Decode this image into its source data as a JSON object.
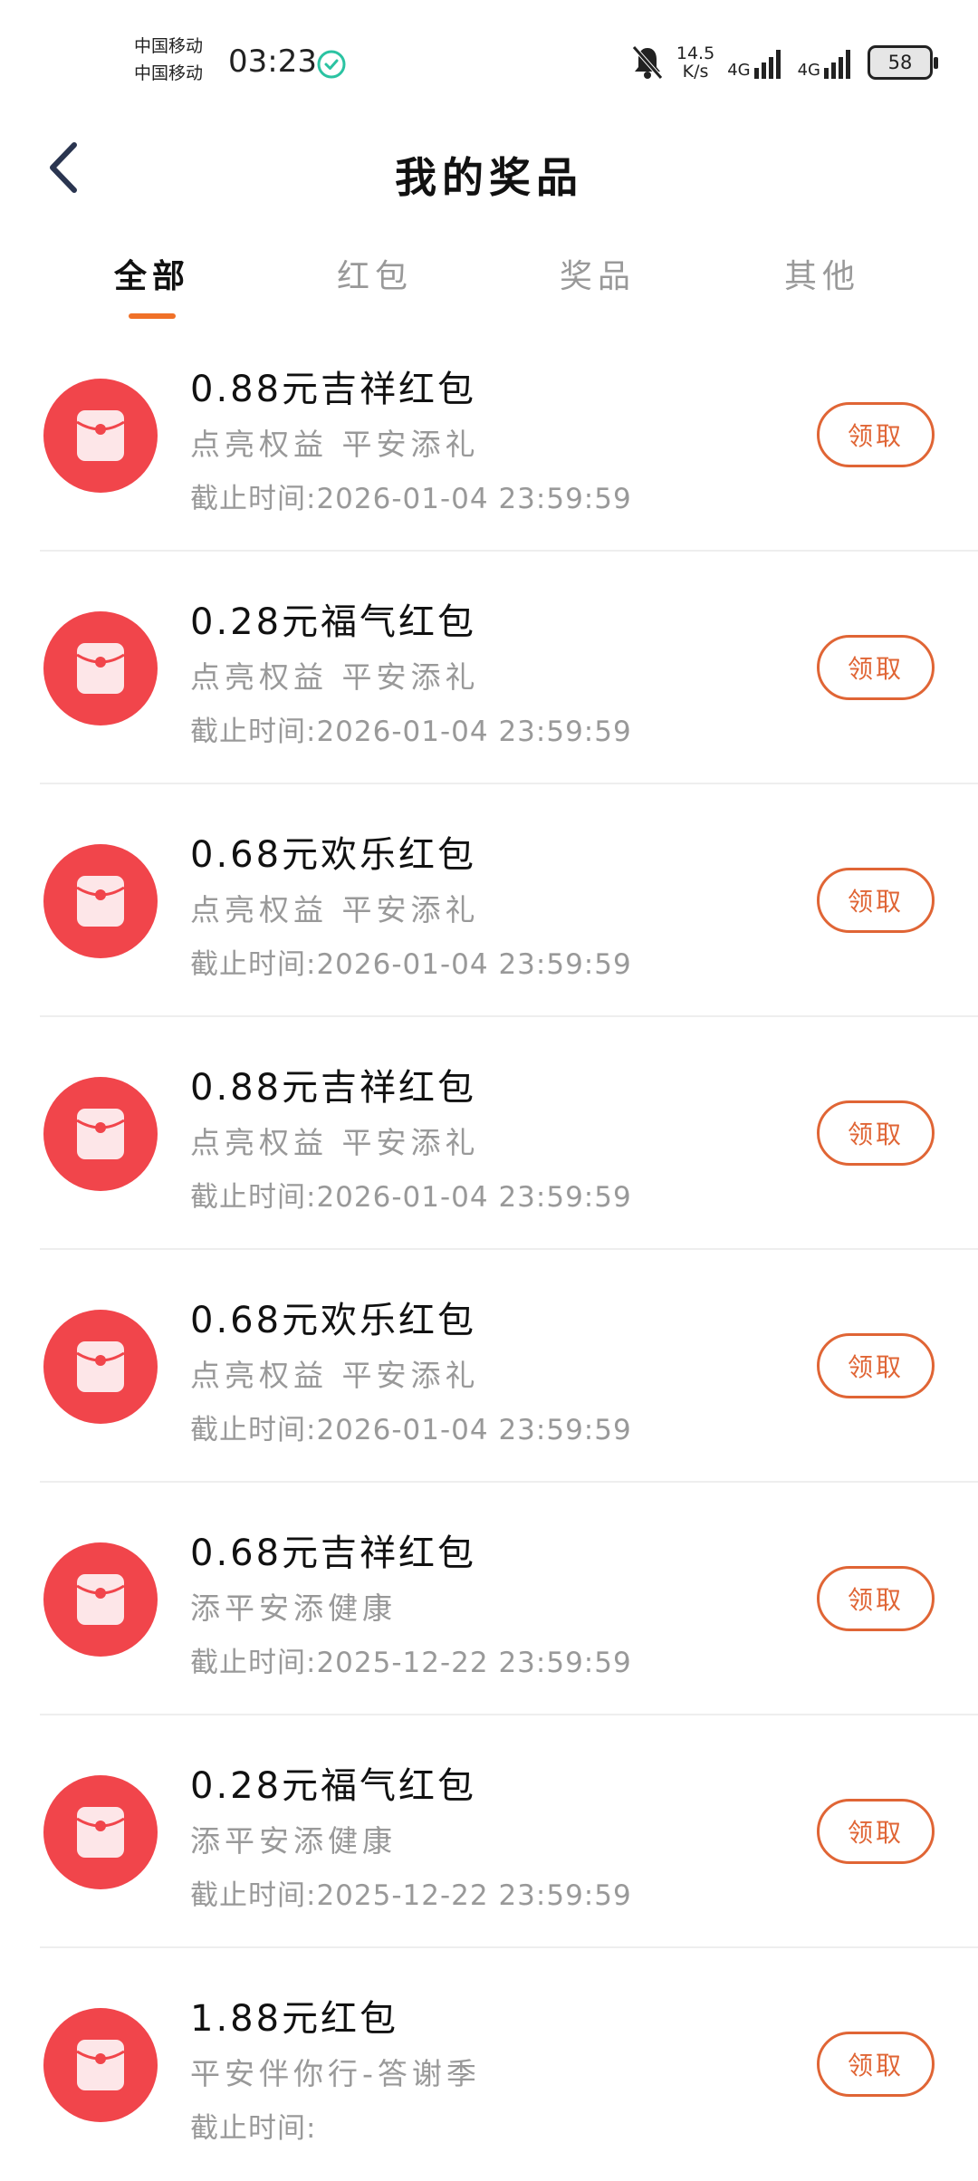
{
  "status_bar": {
    "carrier_1": "中国移动",
    "carrier_2": "中国移动",
    "time": "03:23",
    "net_speed_value": "14.5",
    "net_speed_unit": "K/s",
    "signal_1_label": "4G",
    "signal_2_label": "4G",
    "battery": "58"
  },
  "header": {
    "title": "我的奖品",
    "back_icon": "chevron-left-icon"
  },
  "tabs": [
    {
      "label": "全部",
      "active": true
    },
    {
      "label": "红包",
      "active": false
    },
    {
      "label": "奖品",
      "active": false
    },
    {
      "label": "其他",
      "active": false
    }
  ],
  "prizes": [
    {
      "title": "0.88元吉祥红包",
      "desc": "点亮权益 平安添礼",
      "deadline": "截止时间:2026-01-04 23:59:59",
      "button": "领取"
    },
    {
      "title": "0.28元福气红包",
      "desc": "点亮权益 平安添礼",
      "deadline": "截止时间:2026-01-04 23:59:59",
      "button": "领取"
    },
    {
      "title": "0.68元欢乐红包",
      "desc": "点亮权益 平安添礼",
      "deadline": "截止时间:2026-01-04 23:59:59",
      "button": "领取"
    },
    {
      "title": "0.88元吉祥红包",
      "desc": "点亮权益 平安添礼",
      "deadline": "截止时间:2026-01-04 23:59:59",
      "button": "领取"
    },
    {
      "title": "0.68元欢乐红包",
      "desc": "点亮权益 平安添礼",
      "deadline": "截止时间:2026-01-04 23:59:59",
      "button": "领取"
    },
    {
      "title": "0.68元吉祥红包",
      "desc": "添平安添健康",
      "deadline": "截止时间:2025-12-22 23:59:59",
      "button": "领取"
    },
    {
      "title": "0.28元福气红包",
      "desc": "添平安添健康",
      "deadline": "截止时间:2025-12-22 23:59:59",
      "button": "领取"
    },
    {
      "title": "1.88元红包",
      "desc": "平安伴你行-答谢季",
      "deadline": "截止时间:",
      "button": "领取"
    }
  ],
  "colors": {
    "accent": "#f07128",
    "button": "#e06535",
    "icon_red": "#f1454b"
  }
}
